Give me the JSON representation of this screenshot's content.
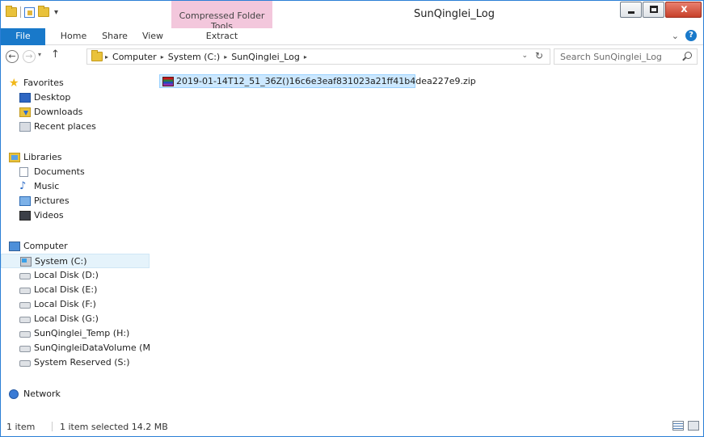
{
  "window": {
    "title": "SunQinglei_Log",
    "context_tab_group": "Compressed Folder Tools",
    "close_glyph": "x"
  },
  "ribbon": {
    "tabs": [
      "File",
      "Home",
      "Share",
      "View",
      "Extract"
    ],
    "expand_glyph": "⌄",
    "help_glyph": "?"
  },
  "nav": {
    "back_glyph": "←",
    "forward_glyph": "→",
    "recent_glyph": "▾",
    "up_glyph": "↑"
  },
  "address": {
    "crumbs": [
      "Computer",
      "System (C:)",
      "SunQinglei_Log"
    ],
    "separator": "▸",
    "dropdown_glyph": "⌄",
    "refresh_glyph": "↻"
  },
  "search": {
    "placeholder": "Search SunQinglei_Log"
  },
  "navpane": {
    "favorites": {
      "label": "Favorites",
      "icon": "star-icon",
      "items": [
        {
          "label": "Desktop",
          "icon": "desktop-icon"
        },
        {
          "label": "Downloads",
          "icon": "downloads-icon"
        },
        {
          "label": "Recent places",
          "icon": "recent-places-icon"
        }
      ]
    },
    "libraries": {
      "label": "Libraries",
      "icon": "libraries-icon",
      "items": [
        {
          "label": "Documents",
          "icon": "documents-icon"
        },
        {
          "label": "Music",
          "icon": "music-icon"
        },
        {
          "label": "Pictures",
          "icon": "pictures-icon"
        },
        {
          "label": "Videos",
          "icon": "videos-icon"
        }
      ]
    },
    "computer": {
      "label": "Computer",
      "icon": "computer-icon",
      "items": [
        {
          "label": "System  (C:)",
          "icon": "drive-c-icon",
          "selected": true
        },
        {
          "label": "Local Disk (D:)",
          "icon": "drive-icon"
        },
        {
          "label": "Local Disk (E:)",
          "icon": "drive-icon"
        },
        {
          "label": "Local Disk (F:)",
          "icon": "drive-icon"
        },
        {
          "label": "Local Disk (G:)",
          "icon": "drive-icon"
        },
        {
          "label": "SunQinglei_Temp (H:)",
          "icon": "drive-icon"
        },
        {
          "label": "SunQingleiDataVolume (M:",
          "icon": "drive-icon"
        },
        {
          "label": "System Reserved  (S:)",
          "icon": "drive-icon"
        }
      ]
    },
    "network": {
      "label": "Network",
      "icon": "network-icon"
    }
  },
  "files": [
    {
      "name": "2019-01-14T12_51_36Z()16c6e3eaf831023a21ff41b4dea227e9.zip",
      "icon": "zip-archive-icon",
      "selected": true
    }
  ],
  "status": {
    "count": "1 item",
    "selection": "1 item selected  14.2 MB"
  },
  "colors": {
    "accent": "#1979ca",
    "context_tab": "#f3c7dc",
    "selection": "#cce8ff",
    "nav_selected": "#e5f3fb"
  }
}
